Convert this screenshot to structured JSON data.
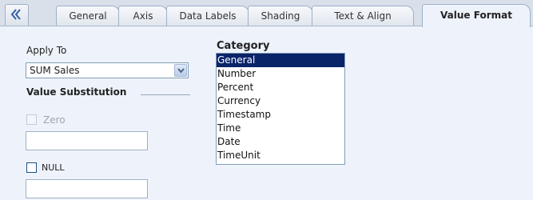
{
  "tabs": [
    {
      "label": "General",
      "active": false
    },
    {
      "label": "Axis",
      "active": false
    },
    {
      "label": "Data Labels",
      "active": false
    },
    {
      "label": "Shading",
      "active": false
    },
    {
      "label": "Text & Align",
      "active": false
    },
    {
      "label": "Value Format",
      "active": true
    }
  ],
  "icons": {
    "back": "chevron-double-left-icon",
    "dropdown": "chevron-down-icon"
  },
  "apply_to": {
    "label": "Apply To",
    "selected": "SUM Sales"
  },
  "value_substitution": {
    "heading": "Value Substitution",
    "zero": {
      "label": "Zero",
      "checked": false,
      "enabled": false,
      "value": ""
    },
    "null": {
      "label": "NULL",
      "checked": false,
      "enabled": true,
      "value": ""
    }
  },
  "category": {
    "heading": "Category",
    "items": [
      "General",
      "Number",
      "Percent",
      "Currency",
      "Timestamp",
      "Time",
      "Date",
      "TimeUnit"
    ],
    "selected": "General"
  },
  "colors": {
    "accent": "#0a246a",
    "background": "#eef3fb"
  }
}
